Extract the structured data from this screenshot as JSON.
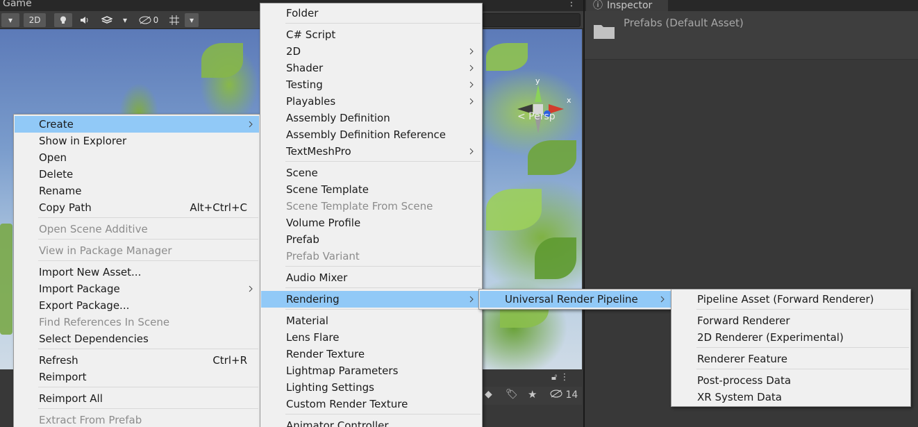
{
  "scene": {
    "tab_label": "Game",
    "toolbar": {
      "mode_2d": "2D",
      "hidden_count": "0"
    },
    "persp_label": "< Persp",
    "gizmo_axes": {
      "y": "y",
      "x": "x"
    },
    "bottom_hidden_count": "14"
  },
  "inspector": {
    "tab_label": "Inspector",
    "asset_title": "Prefabs (Default Asset)"
  },
  "menus": {
    "main": [
      {
        "label": "Create",
        "submenu": true,
        "highlighted": true
      },
      {
        "label": "Show in Explorer"
      },
      {
        "label": "Open"
      },
      {
        "label": "Delete"
      },
      {
        "label": "Rename"
      },
      {
        "label": "Copy Path",
        "shortcut": "Alt+Ctrl+C"
      },
      {
        "label": "Open Scene Additive",
        "disabled": true
      },
      {
        "label": "View in Package Manager",
        "disabled": true
      },
      {
        "label": "Import New Asset..."
      },
      {
        "label": "Import Package",
        "submenu": true
      },
      {
        "label": "Export Package..."
      },
      {
        "label": "Find References In Scene",
        "disabled": true
      },
      {
        "label": "Select Dependencies"
      },
      {
        "label": "Refresh",
        "shortcut": "Ctrl+R"
      },
      {
        "label": "Reimport"
      },
      {
        "label": "Reimport All"
      },
      {
        "label": "Extract From Prefab",
        "disabled": true
      }
    ],
    "create": [
      {
        "label": "Folder"
      },
      {
        "label": "C# Script"
      },
      {
        "label": "2D",
        "submenu": true
      },
      {
        "label": "Shader",
        "submenu": true
      },
      {
        "label": "Testing",
        "submenu": true
      },
      {
        "label": "Playables",
        "submenu": true
      },
      {
        "label": "Assembly Definition"
      },
      {
        "label": "Assembly Definition Reference"
      },
      {
        "label": "TextMeshPro",
        "submenu": true
      },
      {
        "label": "Scene"
      },
      {
        "label": "Scene Template"
      },
      {
        "label": "Scene Template From Scene",
        "disabled": true
      },
      {
        "label": "Volume Profile"
      },
      {
        "label": "Prefab"
      },
      {
        "label": "Prefab Variant",
        "disabled": true
      },
      {
        "label": "Audio Mixer"
      },
      {
        "label": "Rendering",
        "submenu": true,
        "highlighted": true
      },
      {
        "label": "Material"
      },
      {
        "label": "Lens Flare"
      },
      {
        "label": "Render Texture"
      },
      {
        "label": "Lightmap Parameters"
      },
      {
        "label": "Lighting Settings"
      },
      {
        "label": "Custom Render Texture"
      },
      {
        "label": "Animator Controller"
      }
    ],
    "rendering": [
      {
        "label": "Universal Render Pipeline",
        "submenu": true,
        "highlighted": true
      }
    ],
    "urp": [
      {
        "label": "Pipeline Asset (Forward Renderer)"
      },
      {
        "label": "Forward Renderer"
      },
      {
        "label": "2D Renderer (Experimental)"
      },
      {
        "label": "Renderer Feature"
      },
      {
        "label": "Post-process Data"
      },
      {
        "label": "XR System Data"
      }
    ]
  },
  "colors": {
    "menu_bg": "#f0f0f0",
    "menu_highlight": "#91c9f7",
    "menu_disabled_text": "#8c8c8c",
    "editor_bg": "#383838"
  }
}
